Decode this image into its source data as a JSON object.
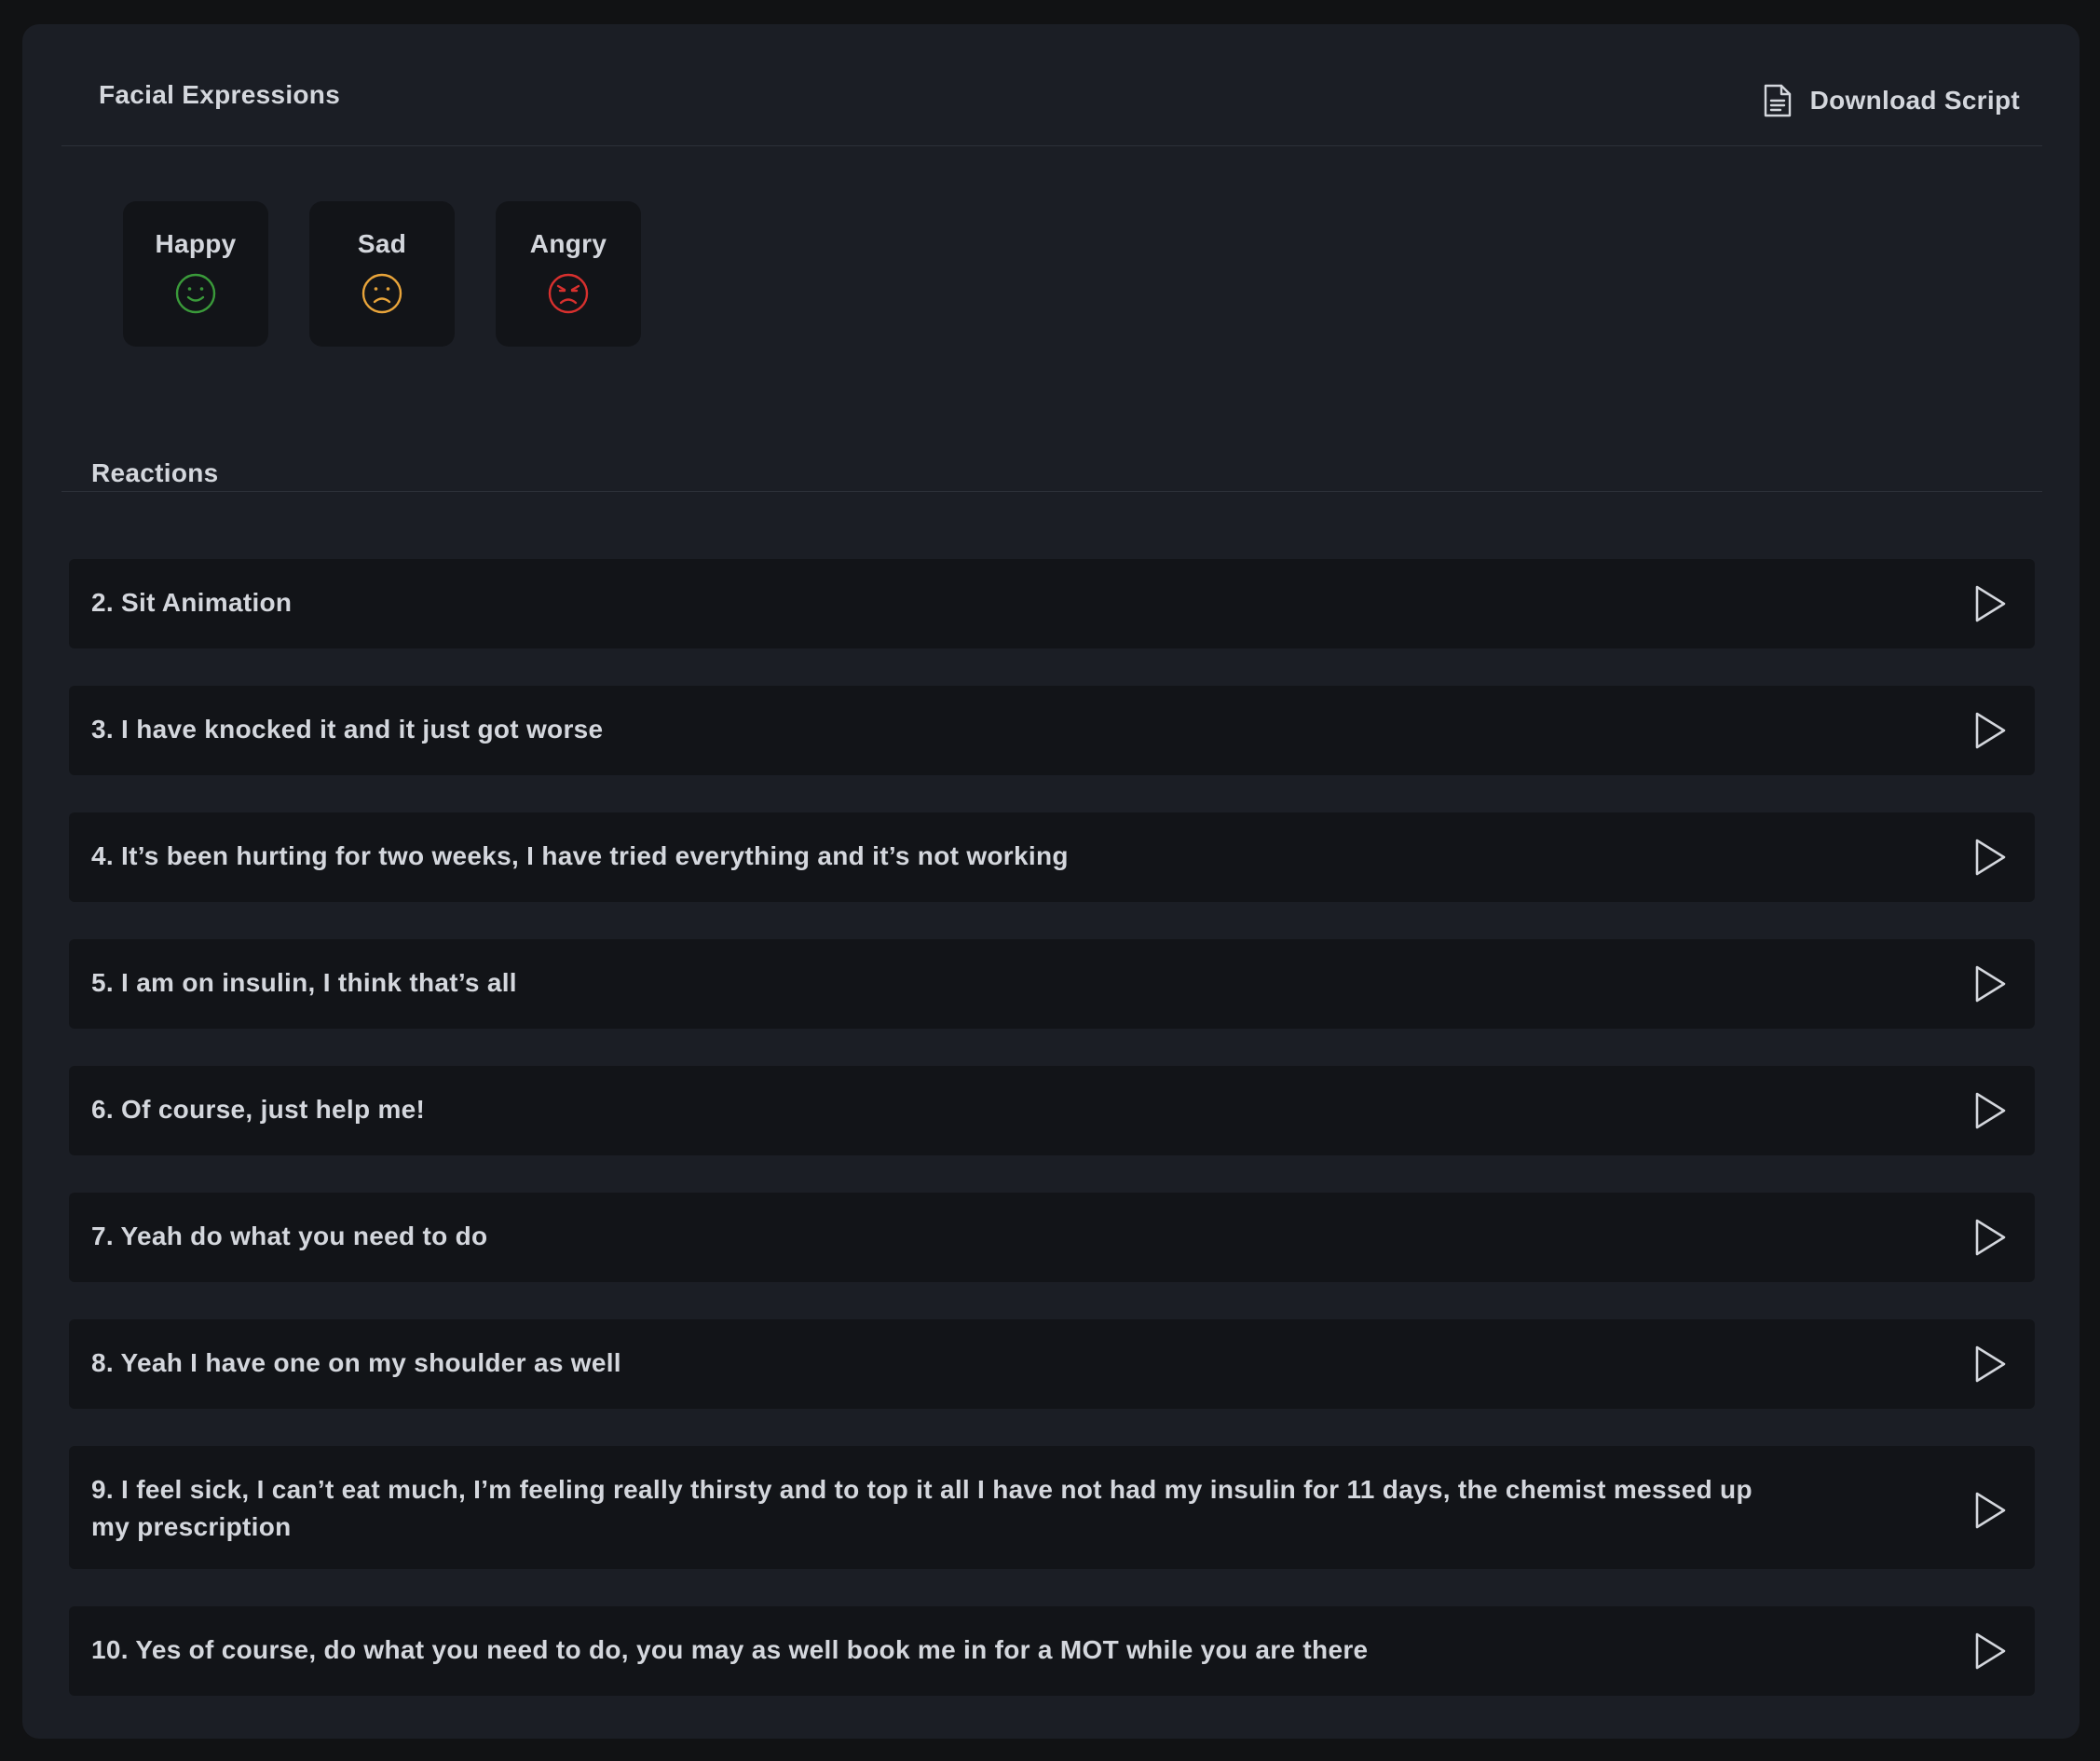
{
  "header": {
    "title": "Facial Expressions",
    "download_label": "Download Script"
  },
  "expressions": [
    {
      "label": "Happy",
      "icon": "happy-face-icon",
      "color": "#3a9a3a"
    },
    {
      "label": "Sad",
      "icon": "sad-face-icon",
      "color": "#e8a43a"
    },
    {
      "label": "Angry",
      "icon": "angry-face-icon",
      "color": "#d8302e"
    }
  ],
  "reactions": {
    "title": "Reactions",
    "items": [
      {
        "label": "2. Sit Animation"
      },
      {
        "label": "3. I have knocked it and it just got worse"
      },
      {
        "label": "4. It’s been hurting for two weeks, I have tried everything and it’s not working"
      },
      {
        "label": "5. I am on insulin, I think that’s all"
      },
      {
        "label": "6. Of course, just help me!"
      },
      {
        "label": "7. Yeah do what you need to do"
      },
      {
        "label": "8. Yeah I have one on my shoulder as well"
      },
      {
        "label": "9. I feel sick, I can’t eat much, I’m feeling really thirsty and to top it all I have not had my insulin for 11 days, the chemist messed up my prescription"
      },
      {
        "label": "10. Yes of course, do what you need to do, you may as well book me in for a MOT while you are there"
      }
    ]
  }
}
